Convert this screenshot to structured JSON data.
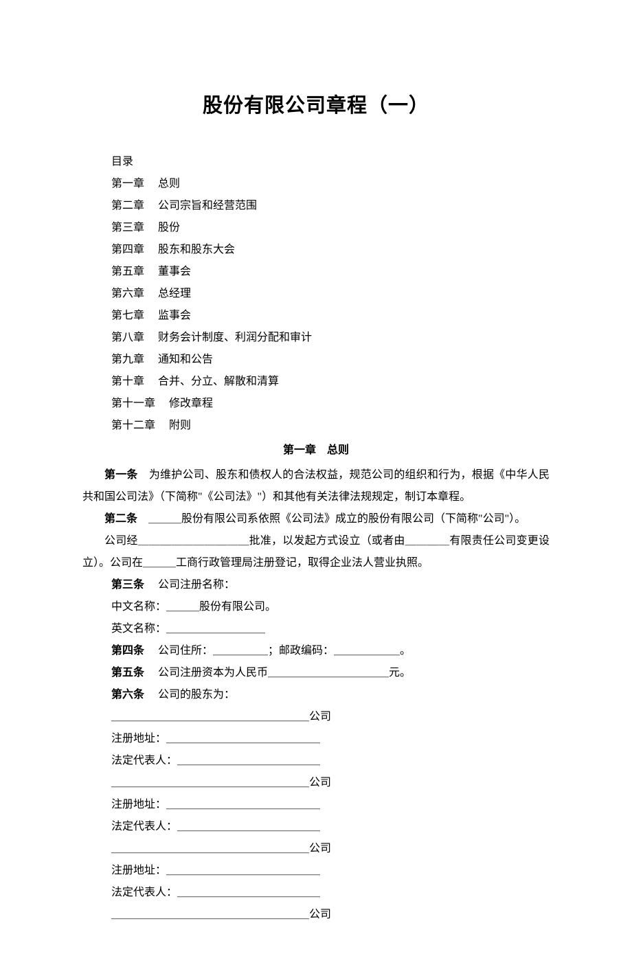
{
  "title": "股份有限公司章程（一）",
  "toc_header": "目录",
  "toc": [
    {
      "chapter": "第一章",
      "name": "总则"
    },
    {
      "chapter": "第二章",
      "name": "公司宗旨和经营范围"
    },
    {
      "chapter": "第三章",
      "name": "股份"
    },
    {
      "chapter": "第四章",
      "name": "股东和股东大会"
    },
    {
      "chapter": "第五章",
      "name": "董事会"
    },
    {
      "chapter": "第六章",
      "name": "总经理"
    },
    {
      "chapter": "第七章",
      "name": "监事会"
    },
    {
      "chapter": "第八章",
      "name": "财务会计制度、利润分配和审计"
    },
    {
      "chapter": "第九章",
      "name": "通知和公告"
    },
    {
      "chapter": "第十章",
      "name": "合并、分立、解散和清算"
    },
    {
      "chapter": "第十一章",
      "name": "修改章程"
    },
    {
      "chapter": "第十二章",
      "name": "附则"
    }
  ],
  "section_heading": "第一章　总则",
  "article1": {
    "label": "第一条",
    "text": "为维护公司、股东和债权人的合法权益，规范公司的组织和行为，根据《中华人民共和国公司法》（下简称\"《公司法》\"）和其他有关法律法规规定，制订本章程。"
  },
  "article2": {
    "label": "第二条",
    "line1": "＿＿＿股份有限公司系依照《公司法》成立的股份有限公司（下简称\"公司\"）。",
    "line2": "公司经＿＿＿＿＿＿＿＿＿＿批准，以发起方式设立（或者由＿＿＿＿有限责任公司变更设立）。公司在＿＿＿工商行政管理局注册登记，取得企业法人营业执照。"
  },
  "article3": {
    "label": "第三条",
    "heading": "公司注册名称：",
    "cn": "中文名称：＿＿＿股份有限公司。",
    "en": "英文名称：＿＿＿＿＿＿＿＿＿"
  },
  "article4": {
    "label": "第四条",
    "text": "公司住所：＿＿＿＿＿；邮政编码：＿＿＿＿＿＿。"
  },
  "article5": {
    "label": "第五条",
    "text": "公司注册资本为人民币＿＿＿＿＿＿＿＿＿＿＿元。"
  },
  "article6": {
    "label": "第六条",
    "heading": "公司的股东为：",
    "shareholders": [
      {
        "company": "＿＿＿＿＿＿＿＿＿＿＿＿＿＿＿＿＿＿公司",
        "addr": "注册地址：＿＿＿＿＿＿＿＿＿＿＿＿＿＿",
        "rep": "法定代表人：＿＿＿＿＿＿＿＿＿＿＿＿＿"
      },
      {
        "company": "＿＿＿＿＿＿＿＿＿＿＿＿＿＿＿＿＿＿公司",
        "addr": "注册地址：＿＿＿＿＿＿＿＿＿＿＿＿＿＿",
        "rep": "法定代表人：＿＿＿＿＿＿＿＿＿＿＿＿＿"
      },
      {
        "company": "＿＿＿＿＿＿＿＿＿＿＿＿＿＿＿＿＿＿公司",
        "addr": "注册地址：＿＿＿＿＿＿＿＿＿＿＿＿＿＿",
        "rep": "法定代表人：＿＿＿＿＿＿＿＿＿＿＿＿＿"
      },
      {
        "company": "＿＿＿＿＿＿＿＿＿＿＿＿＿＿＿＿＿＿公司",
        "addr": "",
        "rep": ""
      }
    ]
  }
}
